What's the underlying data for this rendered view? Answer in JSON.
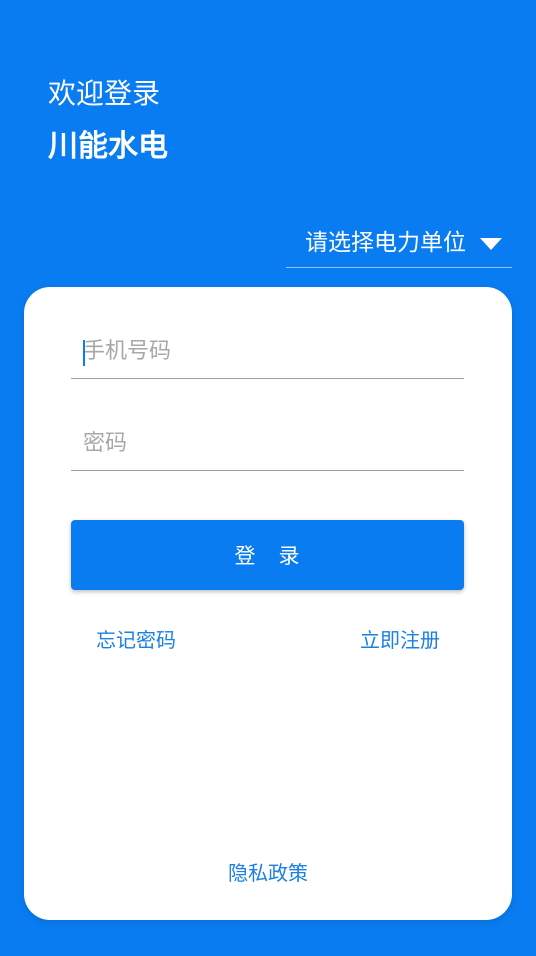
{
  "header": {
    "welcome": "欢迎登录",
    "company": "川能水电"
  },
  "unit_selector": {
    "label": "请选择电力单位",
    "icon": "caret-down-icon"
  },
  "form": {
    "phone_placeholder": "手机号码",
    "password_placeholder": "密码",
    "login_label": "登　录",
    "forgot_label": "忘记密码",
    "register_label": "立即注册",
    "privacy_label": "隐私政策"
  },
  "colors": {
    "primary": "#0a7cf2",
    "link": "#1a7fe6",
    "card": "#ffffff"
  }
}
